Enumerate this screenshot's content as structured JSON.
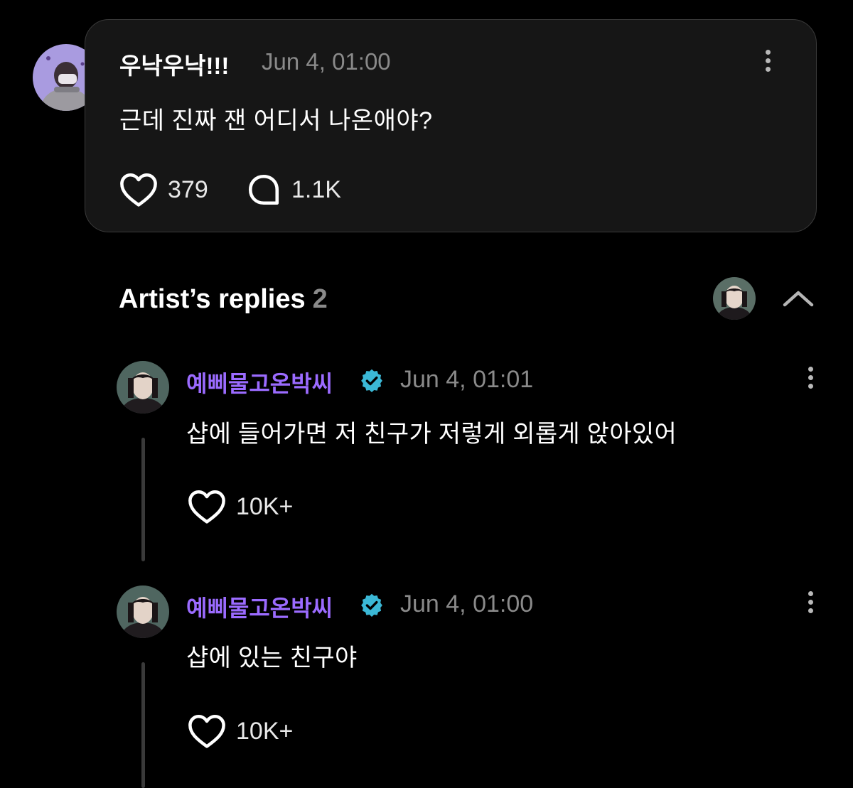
{
  "post": {
    "author": "우낙우낙!!!",
    "timestamp": "Jun 4, 01:00",
    "text": "근데 진짜 잰 어디서 나온애야?",
    "likes": "379",
    "comments": "1.1K"
  },
  "replies_section": {
    "title": "Artist’s replies",
    "count": "2"
  },
  "replies": [
    {
      "author": "예삐물고온박씨",
      "timestamp": "Jun 4, 01:01",
      "text": "샵에 들어가면 저 친구가 저렇게 외롭게 앉아있어",
      "likes": "10K+"
    },
    {
      "author": "예삐물고온박씨",
      "timestamp": "Jun 4, 01:00",
      "text": "샵에 있는 친구야",
      "likes": "10K+"
    }
  ],
  "colors": {
    "background": "#000000",
    "card": "#161616",
    "artist_name": "#9b6bff",
    "verified_badge": "#3bb8d6",
    "muted_text": "#8a8a8a"
  },
  "icons": [
    "heart-icon",
    "comment-bubble-icon",
    "more-options-icon",
    "verified-badge-icon",
    "chevron-up-icon"
  ]
}
